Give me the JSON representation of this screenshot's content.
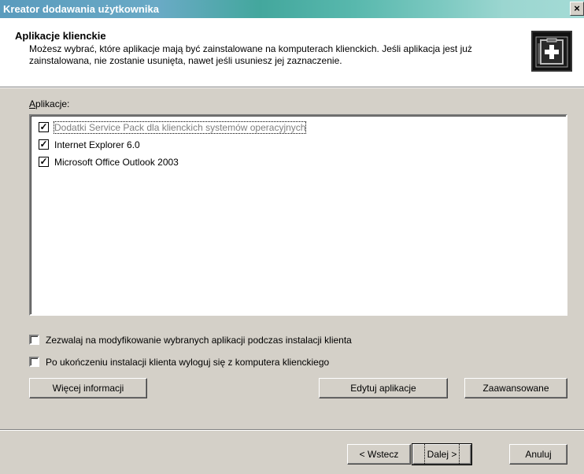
{
  "window": {
    "title": "Kreator dodawania użytkownika",
    "close_glyph": "×"
  },
  "header": {
    "title": "Aplikacje klienckie",
    "description": "Możesz wybrać, które aplikacje mają być zainstalowane na komputerach klienckich. Jeśli aplikacja jest już zainstalowana, nie zostanie usunięta, nawet jeśli usuniesz jej zaznaczenie.",
    "icon": "first-aid-kit-icon"
  },
  "apps": {
    "label": "Aplikacje:",
    "items": [
      {
        "label": "Dodatki Service Pack dla klienckich systemów operacyjnych",
        "checked": true,
        "dimmed": true
      },
      {
        "label": "Internet Explorer 6.0",
        "checked": true,
        "dimmed": false
      },
      {
        "label": "Microsoft Office Outlook 2003",
        "checked": true,
        "dimmed": false
      }
    ]
  },
  "options": {
    "allow_modify": {
      "label": "Zezwalaj na modyfikowanie wybranych aplikacji podczas instalacji klienta",
      "checked": false
    },
    "logoff": {
      "label": "Po ukończeniu instalacji klienta wyloguj się z komputera klienckiego",
      "checked": false
    }
  },
  "buttons": {
    "more_info": "Więcej informacji",
    "edit_apps": "Edytuj aplikacje",
    "advanced": "Zaawansowane",
    "back": "< Wstecz",
    "next": "Dalej >",
    "cancel": "Anuluj"
  }
}
